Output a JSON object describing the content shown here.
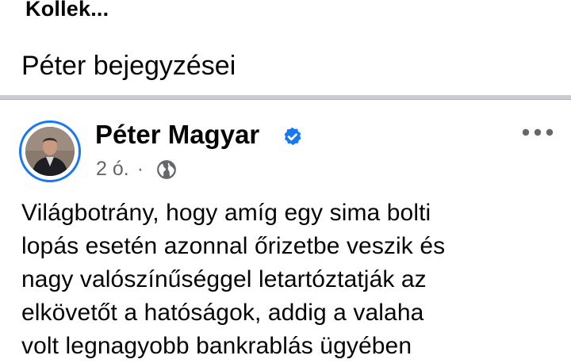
{
  "header": {
    "title": "Kollek..."
  },
  "section": {
    "title": "Péter bejegyzései"
  },
  "post": {
    "author": "Péter Magyar",
    "time": "2 ó.",
    "separator": "·",
    "icons": {
      "verified": "verified-badge-icon",
      "audience": "globe-icon",
      "more": "more-options-icon"
    },
    "colors": {
      "accent": "#1877f2",
      "meta": "#65676b"
    },
    "text": "Világbotrány, hogy amíg egy sima bolti\nlopás esetén azonnal őrizetbe veszik és\nnagy valószínűséggel letartóztatják az\nelkövetőt a hatóságok, addig a valaha\nvolt legnagyobb bankrablás ügyében"
  }
}
